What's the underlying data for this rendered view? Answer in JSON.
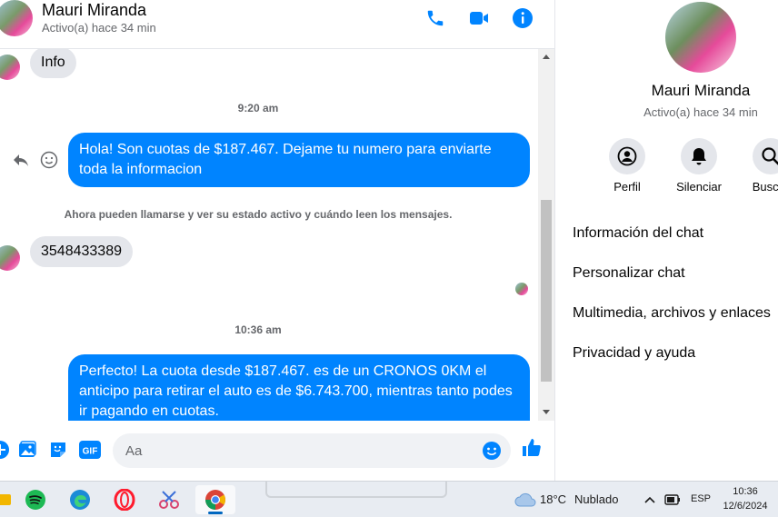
{
  "header": {
    "name": "Mauri Miranda",
    "status": "Activo(a) hace 34 min",
    "icons": [
      "phone-icon",
      "video-icon",
      "info-icon"
    ],
    "accent": "#0084ff"
  },
  "messages": {
    "incoming_1": "Info",
    "time_1": "9:20 am",
    "outgoing_1": "Hola! Son cuotas de $187.467. Dejame tu numero para enviarte toda la informacion",
    "system_notice": "Ahora pueden llamarse y ver su estado activo y cuándo leen los mensajes.",
    "incoming_2": "3548433389",
    "time_2": "10:36 am",
    "outgoing_2": "Perfecto! La cuota desde $187.467. es de un CRONOS 0KM el anticipo para retirar el auto es de $6.743.700, mientras tanto podes ir pagando en cuotas."
  },
  "composer": {
    "placeholder": "Aa",
    "icons": [
      "plus-circle-icon",
      "image-icon",
      "sticker-icon",
      "gif-icon",
      "emoji-icon",
      "like-icon"
    ],
    "gif_label": "GIF"
  },
  "profile": {
    "name": "Mauri Miranda",
    "status": "Activo(a) hace 34 min",
    "actions": [
      {
        "label": "Perfil",
        "icon": "profile-icon"
      },
      {
        "label": "Silenciar",
        "icon": "bell-icon"
      },
      {
        "label": "Buscar",
        "icon": "search-icon"
      }
    ],
    "sections": [
      "Información del chat",
      "Personalizar chat",
      "Multimedia, archivos y enlaces",
      "Privacidad y ayuda"
    ]
  },
  "taskbar": {
    "apps": [
      "spotify-icon",
      "edge-icon",
      "opera-icon",
      "snipping-tool-icon",
      "chrome-icon"
    ],
    "weather_temp": "18°C",
    "weather_desc": "Nublado",
    "language": "ESP",
    "time": "10:36",
    "date": "12/6/2024"
  }
}
